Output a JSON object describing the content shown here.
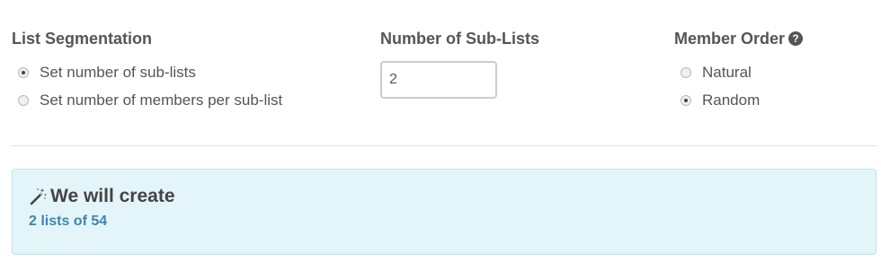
{
  "segmentation": {
    "label": "List Segmentation",
    "options": [
      {
        "label": "Set number of sub-lists",
        "checked": true
      },
      {
        "label": "Set number of members per sub-list",
        "checked": false
      }
    ]
  },
  "sublists": {
    "label": "Number of Sub-Lists",
    "value": "2"
  },
  "member_order": {
    "label": "Member Order",
    "help_icon": "question-circle-icon",
    "options": [
      {
        "label": "Natural",
        "checked": false
      },
      {
        "label": "Random",
        "checked": true
      }
    ]
  },
  "result": {
    "icon": "magic-wand-icon",
    "title": "We will create",
    "detail": "2 lists of 54"
  },
  "colors": {
    "result_background": "#e4f5fa",
    "result_border": "#b9e4f0",
    "result_detail": "#3a87ad",
    "text": "#555555"
  }
}
